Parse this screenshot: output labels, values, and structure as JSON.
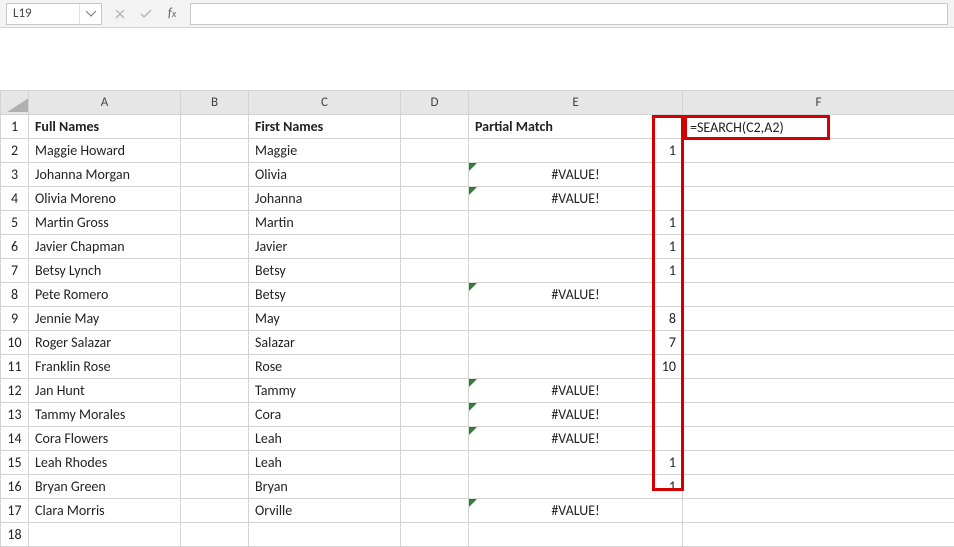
{
  "name_box": "L19",
  "formula_bar": "",
  "headers": {
    "A": "A",
    "B": "B",
    "C": "C",
    "D": "D",
    "E": "E",
    "F": "F"
  },
  "columns": {
    "fullnames": "Full Names",
    "firstnames": "First Names",
    "partial": "Partial Match"
  },
  "formula_display": "=SEARCH(C2,A2)",
  "rows": [
    {
      "n": "1",
      "a": "Full Names",
      "c": "First Names",
      "e": "Partial Match",
      "bold": true
    },
    {
      "n": "2",
      "a": "Maggie Howard",
      "c": "Maggie",
      "e": "1",
      "num": true
    },
    {
      "n": "3",
      "a": "Johanna Morgan",
      "c": "Olivia",
      "e": "#VALUE!",
      "err": true
    },
    {
      "n": "4",
      "a": "Olivia Moreno",
      "c": "Johanna",
      "e": "#VALUE!",
      "err": true
    },
    {
      "n": "5",
      "a": "Martin Gross",
      "c": "Martin",
      "e": "1",
      "num": true
    },
    {
      "n": "6",
      "a": "Javier Chapman",
      "c": "Javier",
      "e": "1",
      "num": true
    },
    {
      "n": "7",
      "a": "Betsy Lynch",
      "c": "Betsy",
      "e": "1",
      "num": true
    },
    {
      "n": "8",
      "a": "Pete Romero",
      "c": "Betsy",
      "e": "#VALUE!",
      "err": true
    },
    {
      "n": "9",
      "a": "Jennie May",
      "c": "May",
      "e": "8",
      "num": true
    },
    {
      "n": "10",
      "a": "Roger Salazar",
      "c": "Salazar",
      "e": "7",
      "num": true
    },
    {
      "n": "11",
      "a": "Franklin Rose",
      "c": "Rose",
      "e": "10",
      "num": true
    },
    {
      "n": "12",
      "a": "Jan Hunt",
      "c": "Tammy",
      "e": "#VALUE!",
      "err": true
    },
    {
      "n": "13",
      "a": "Tammy Morales",
      "c": "Cora",
      "e": "#VALUE!",
      "err": true
    },
    {
      "n": "14",
      "a": "Cora Flowers",
      "c": "Leah",
      "e": "#VALUE!",
      "err": true
    },
    {
      "n": "15",
      "a": "Leah Rhodes",
      "c": "Leah",
      "e": "1",
      "num": true
    },
    {
      "n": "16",
      "a": "Bryan Green",
      "c": "Bryan",
      "e": "1",
      "num": true
    },
    {
      "n": "17",
      "a": "Clara Morris",
      "c": "Orville",
      "e": "#VALUE!",
      "err": true
    },
    {
      "n": "18",
      "a": "",
      "c": "",
      "e": ""
    }
  ]
}
